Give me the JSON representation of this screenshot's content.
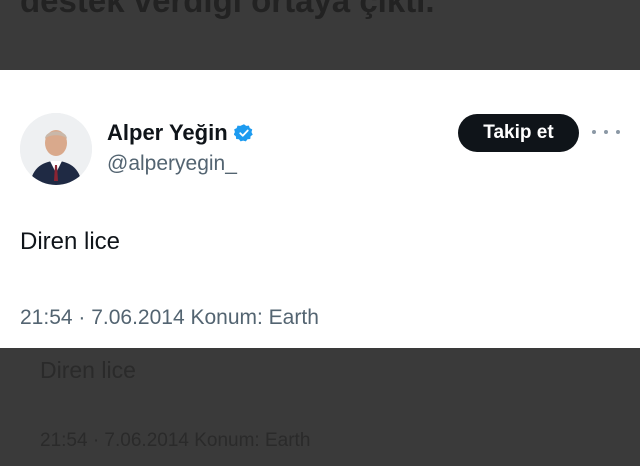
{
  "background": {
    "headline": "destek verdiği ortaya çıktı.",
    "tweet_text": "Diren lice",
    "tweet_meta": "21:54 · 7.06.2014 Konum: Earth"
  },
  "tweet": {
    "author_name": "Alper Yeğin",
    "handle": "@alperyegin_",
    "follow_label": "Takip et",
    "text": "Diren lice",
    "meta": "21:54 · 7.06.2014 Konum: Earth",
    "verified": true
  },
  "icons": {
    "verified": "verified-badge-icon",
    "more": "more-options-icon"
  },
  "colors": {
    "verified_blue": "#1d9bf0",
    "follow_bg": "#0f1419",
    "secondary_text": "#536471"
  }
}
